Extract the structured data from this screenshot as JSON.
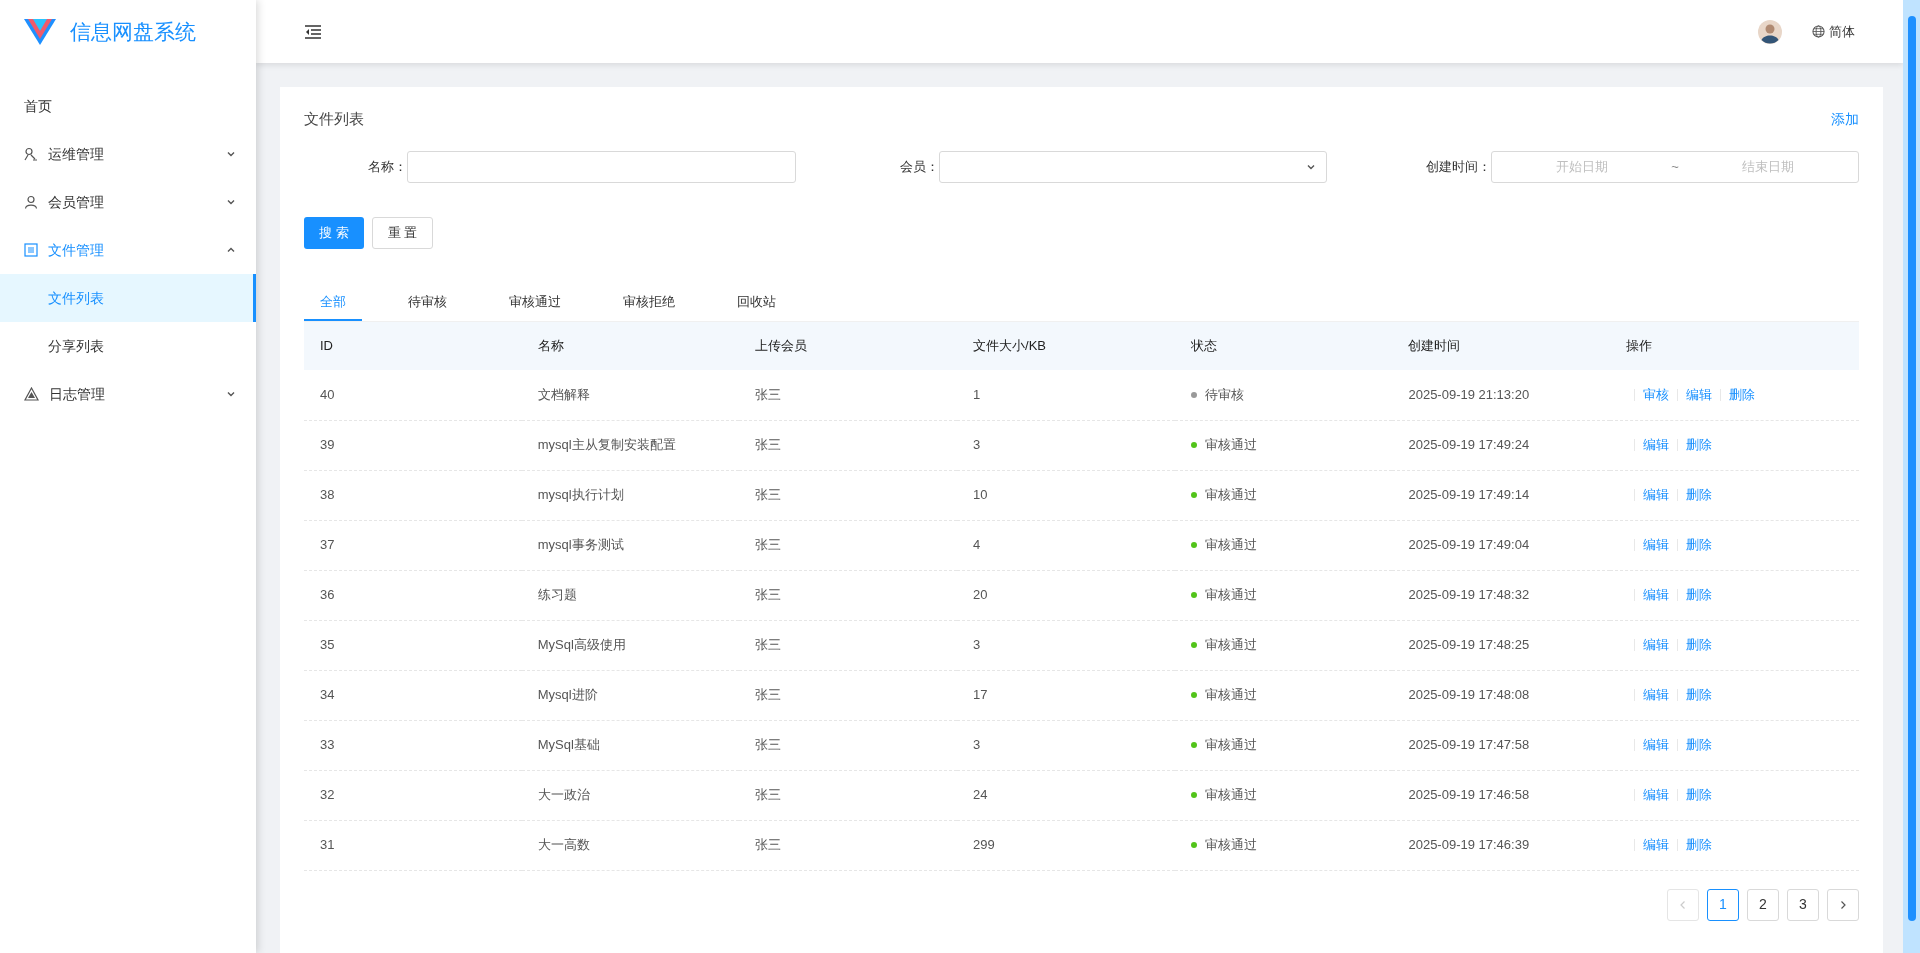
{
  "app": {
    "title": "信息网盘系统"
  },
  "sidebar": {
    "items": [
      {
        "label": "首页",
        "kind": "link",
        "active": false
      },
      {
        "label": "运维管理",
        "kind": "group",
        "expanded": false,
        "active": false
      },
      {
        "label": "会员管理",
        "kind": "group",
        "expanded": false,
        "active": false
      },
      {
        "label": "文件管理",
        "kind": "group",
        "expanded": true,
        "active": true,
        "children": [
          {
            "label": "文件列表",
            "selected": true
          },
          {
            "label": "分享列表",
            "selected": false
          }
        ]
      },
      {
        "label": "日志管理",
        "kind": "group",
        "expanded": false,
        "active": false
      }
    ]
  },
  "header": {
    "language": "简体"
  },
  "card": {
    "title": "文件列表",
    "add_link": "添加"
  },
  "filters": [
    {
      "kind": "text",
      "label": "名称："
    },
    {
      "kind": "select",
      "label": "会员："
    },
    {
      "kind": "daterange",
      "label": "创建时间：",
      "start_placeholder": "开始日期",
      "separator": "~",
      "end_placeholder": "结束日期"
    }
  ],
  "buttons": [
    {
      "label": "搜 索",
      "kind": "primary"
    },
    {
      "label": "重 置",
      "kind": "default"
    }
  ],
  "tabs": [
    {
      "label": "全部",
      "selected": true
    },
    {
      "label": "待审核",
      "selected": false
    },
    {
      "label": "审核通过",
      "selected": false
    },
    {
      "label": "审核拒绝",
      "selected": false
    },
    {
      "label": "回收站",
      "selected": false
    }
  ],
  "table": {
    "columns": [
      "ID",
      "名称",
      "上传会员",
      "文件大小/KB",
      "状态",
      "创建时间",
      "操作"
    ],
    "rows": [
      {
        "id": "40",
        "name": "文档解释",
        "member": "张三",
        "size": "1",
        "status": "待审核",
        "kind": "pending",
        "created": "2025-09-19 21:13:20",
        "actions": [
          "审核",
          "编辑",
          "删除"
        ]
      },
      {
        "id": "39",
        "name": "mysql主从复制安装配置",
        "member": "张三",
        "size": "3",
        "status": "审核通过",
        "kind": "approved",
        "created": "2025-09-19 17:49:24",
        "actions": [
          "编辑",
          "删除"
        ]
      },
      {
        "id": "38",
        "name": "mysql执行计划",
        "member": "张三",
        "size": "10",
        "status": "审核通过",
        "kind": "approved",
        "created": "2025-09-19 17:49:14",
        "actions": [
          "编辑",
          "删除"
        ]
      },
      {
        "id": "37",
        "name": "mysql事务测试",
        "member": "张三",
        "size": "4",
        "status": "审核通过",
        "kind": "approved",
        "created": "2025-09-19 17:49:04",
        "actions": [
          "编辑",
          "删除"
        ]
      },
      {
        "id": "36",
        "name": "练习题",
        "member": "张三",
        "size": "20",
        "status": "审核通过",
        "kind": "approved",
        "created": "2025-09-19 17:48:32",
        "actions": [
          "编辑",
          "删除"
        ]
      },
      {
        "id": "35",
        "name": "MySql高级使用",
        "member": "张三",
        "size": "3",
        "status": "审核通过",
        "kind": "approved",
        "created": "2025-09-19 17:48:25",
        "actions": [
          "编辑",
          "删除"
        ]
      },
      {
        "id": "34",
        "name": "Mysql进阶",
        "member": "张三",
        "size": "17",
        "status": "审核通过",
        "kind": "approved",
        "created": "2025-09-19 17:48:08",
        "actions": [
          "编辑",
          "删除"
        ]
      },
      {
        "id": "33",
        "name": "MySql基础",
        "member": "张三",
        "size": "3",
        "status": "审核通过",
        "kind": "approved",
        "created": "2025-09-19 17:47:58",
        "actions": [
          "编辑",
          "删除"
        ]
      },
      {
        "id": "32",
        "name": "大一政治",
        "member": "张三",
        "size": "24",
        "status": "审核通过",
        "kind": "approved",
        "created": "2025-09-19 17:46:58",
        "actions": [
          "编辑",
          "删除"
        ]
      },
      {
        "id": "31",
        "name": "大一高数",
        "member": "张三",
        "size": "299",
        "status": "审核通过",
        "kind": "approved",
        "created": "2025-09-19 17:46:39",
        "actions": [
          "编辑",
          "删除"
        ]
      }
    ]
  },
  "pagination": {
    "prev_disabled": true,
    "pages": [
      {
        "label": "1",
        "selected": true
      },
      {
        "label": "2",
        "selected": false
      },
      {
        "label": "3",
        "selected": false
      }
    ]
  }
}
